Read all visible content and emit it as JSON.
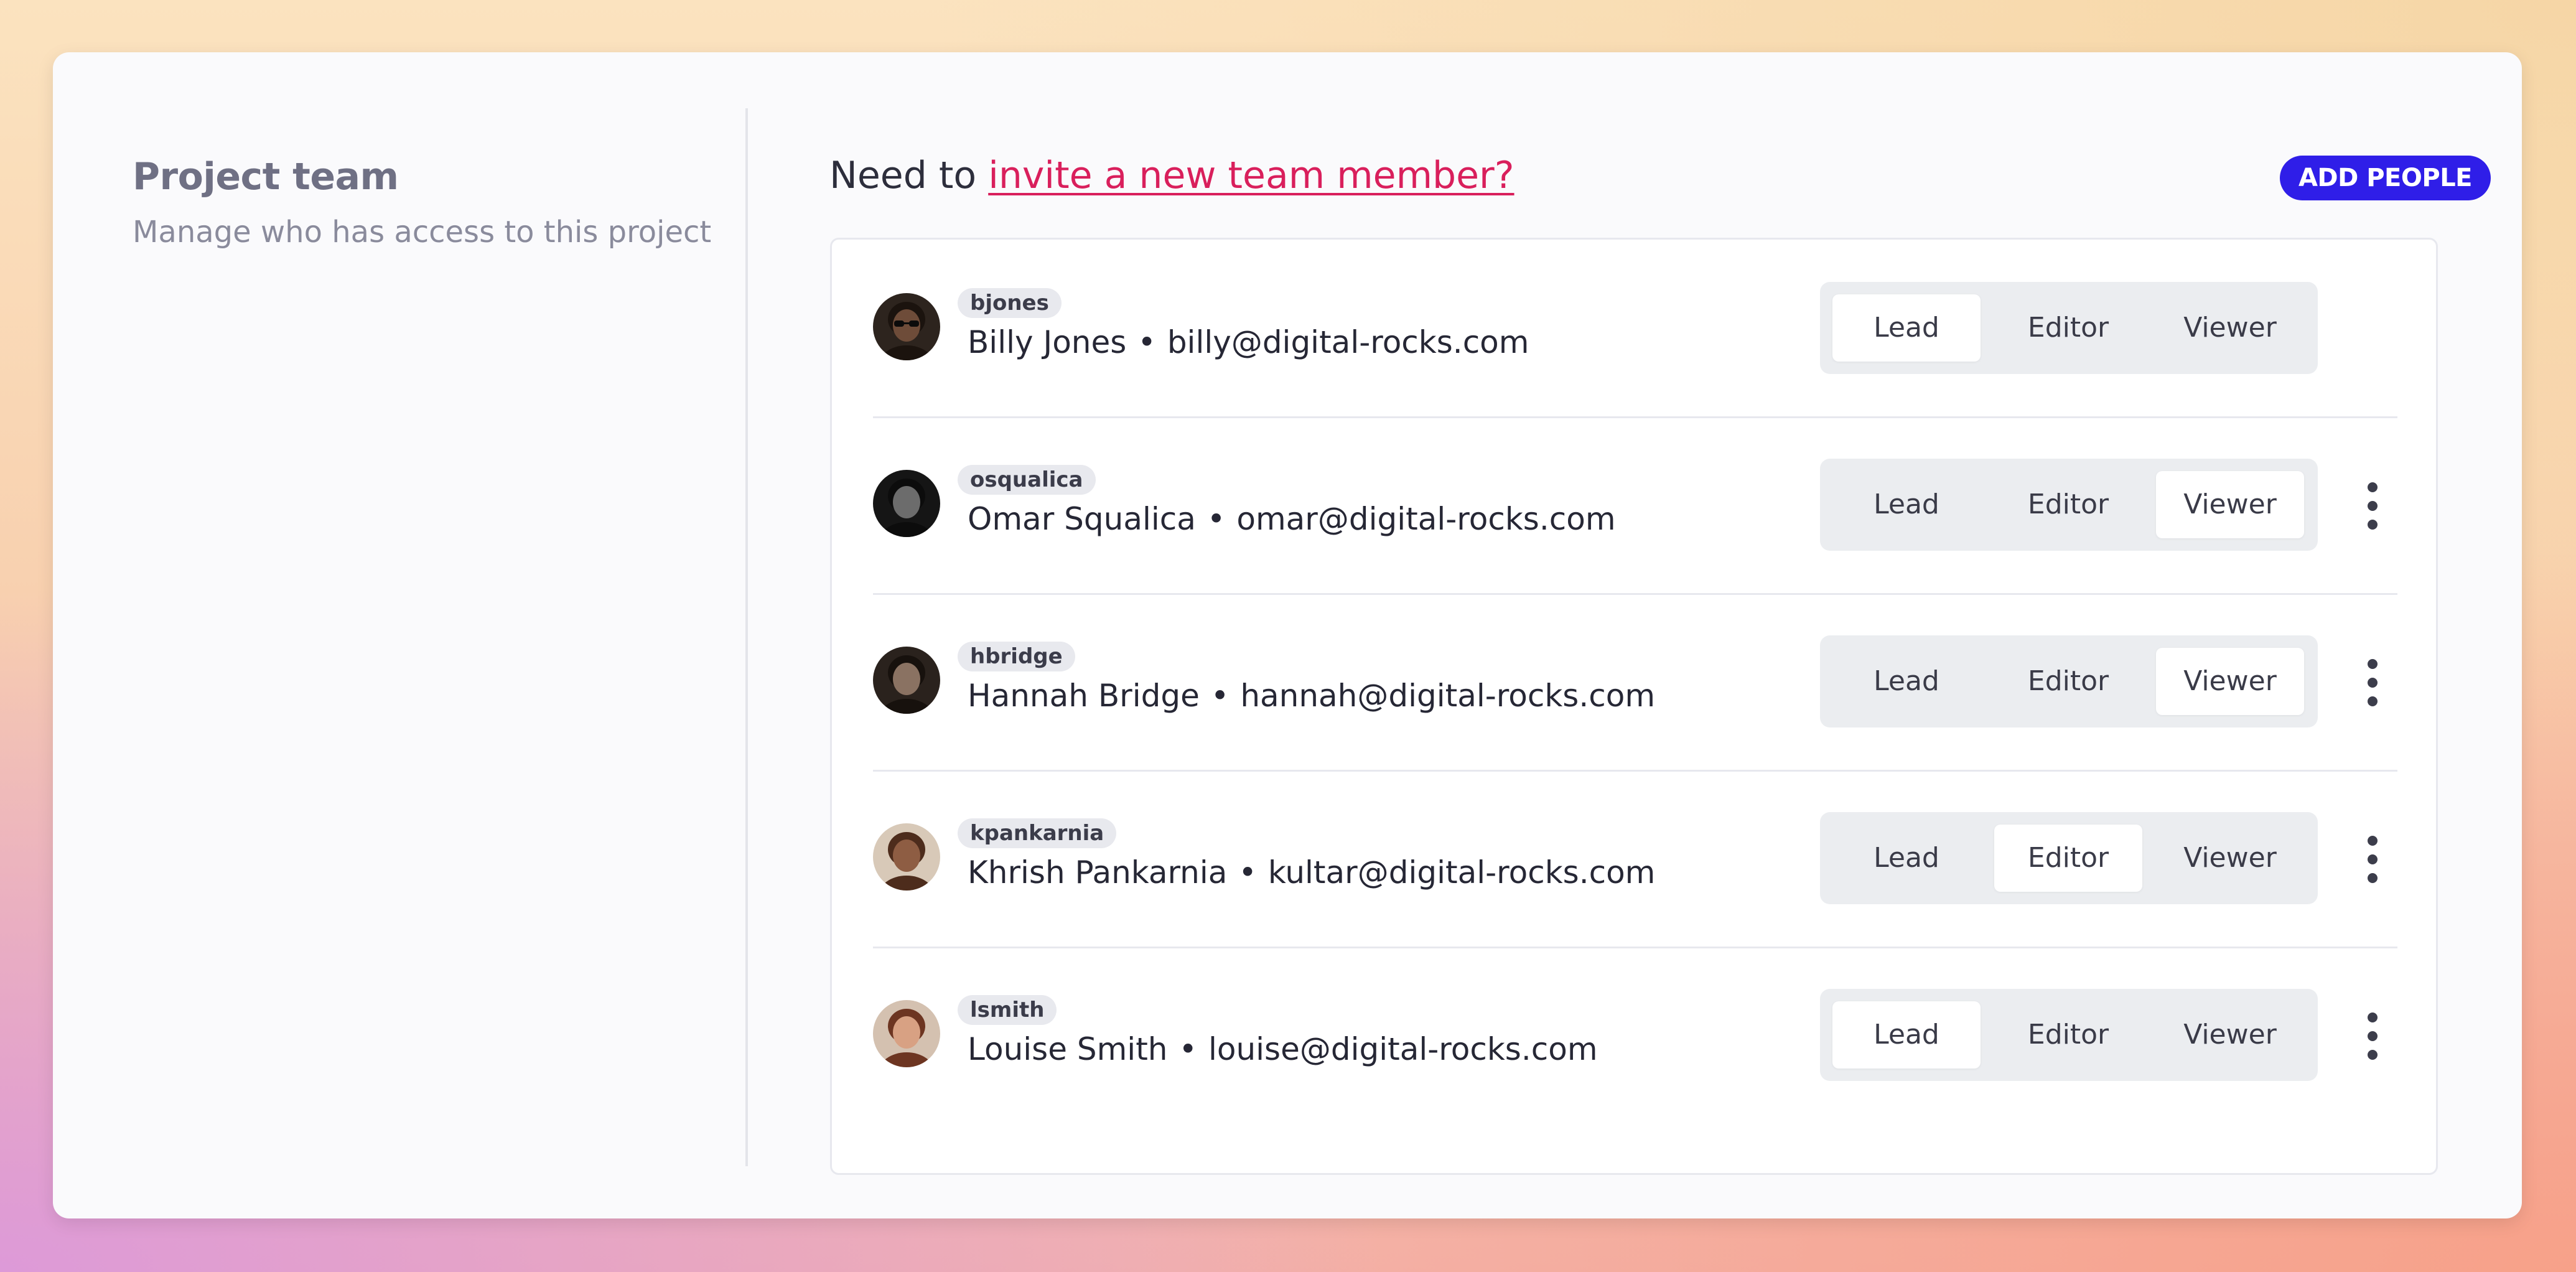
{
  "left": {
    "title": "Project team",
    "subtitle": "Manage who has access to this project"
  },
  "header": {
    "invite_prefix": "Need to",
    "invite_link": "invite a new team member?",
    "add_people_label": "ADD PEOPLE"
  },
  "roles": [
    "Lead",
    "Editor",
    "Viewer"
  ],
  "members": [
    {
      "username": "bjones",
      "name": "Billy Jones",
      "separator": "•",
      "email": "billy@digital-rocks.com",
      "role": "Lead",
      "has_menu": false
    },
    {
      "username": "osqualica",
      "name": "Omar Squalica",
      "separator": "•",
      "email": "omar@digital-rocks.com",
      "role": "Viewer",
      "has_menu": true
    },
    {
      "username": "hbridge",
      "name": "Hannah Bridge",
      "separator": "•",
      "email": "hannah@digital-rocks.com",
      "role": "Viewer",
      "has_menu": true
    },
    {
      "username": "kpankarnia",
      "name": "Khrish Pankarnia",
      "separator": "•",
      "email": "kultar@digital-rocks.com",
      "role": "Editor",
      "has_menu": true
    },
    {
      "username": "lsmith",
      "name": "Louise Smith",
      "separator": "•",
      "email": "louise@digital-rocks.com",
      "role": "Lead",
      "has_menu": true
    }
  ],
  "icons": {
    "avatar": "avatar-photo-icon",
    "menu": "more-vertical-icon"
  },
  "colors": {
    "accent": "#2f1ee8",
    "link": "#d91f5c",
    "text": "#262735",
    "muted": "#6f7084"
  }
}
